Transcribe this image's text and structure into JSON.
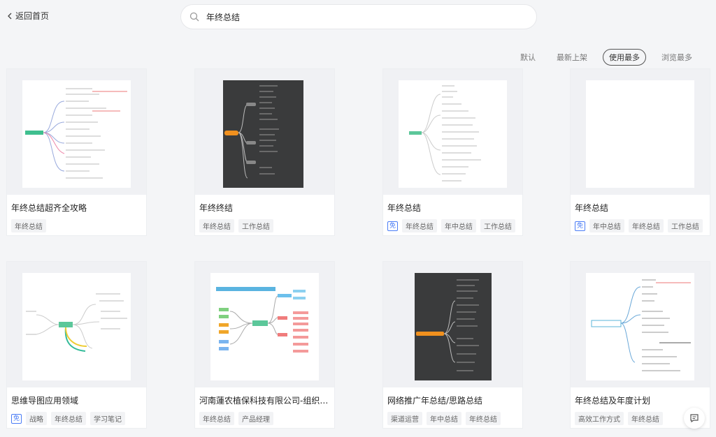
{
  "nav": {
    "back_label": "返回首页"
  },
  "search": {
    "value": "年终总结"
  },
  "sort": [
    "默认",
    "最新上架",
    "使用最多",
    "浏览最多"
  ],
  "cards": [
    {
      "title": "年终总结超齐全攻略",
      "free": "",
      "tags": [
        "年终总结"
      ]
    },
    {
      "title": "年终终结",
      "free": "",
      "tags": [
        "年终总结",
        "工作总结"
      ]
    },
    {
      "title": "年终总结",
      "free": "免",
      "tags": [
        "年终总结",
        "年中总结",
        "工作总结"
      ]
    },
    {
      "title": "年终总结",
      "free": "免",
      "tags": [
        "年中总结",
        "年终总结",
        "工作总结"
      ]
    },
    {
      "title": "思维导图应用领域",
      "free": "免",
      "tags": [
        "战略",
        "年终总结",
        "学习笔记"
      ]
    },
    {
      "title": "河南蓮农植保科技有限公司-组织结...",
      "free": "",
      "tags": [
        "年终总结",
        "产品经理"
      ]
    },
    {
      "title": "网络推广年总结/思路总结",
      "free": "",
      "tags": [
        "渠道运营",
        "年中总结",
        "年终总结"
      ]
    },
    {
      "title": "年终总结及年度计划",
      "free": "",
      "tags": [
        "高效工作方式",
        "年终总结"
      ]
    }
  ]
}
